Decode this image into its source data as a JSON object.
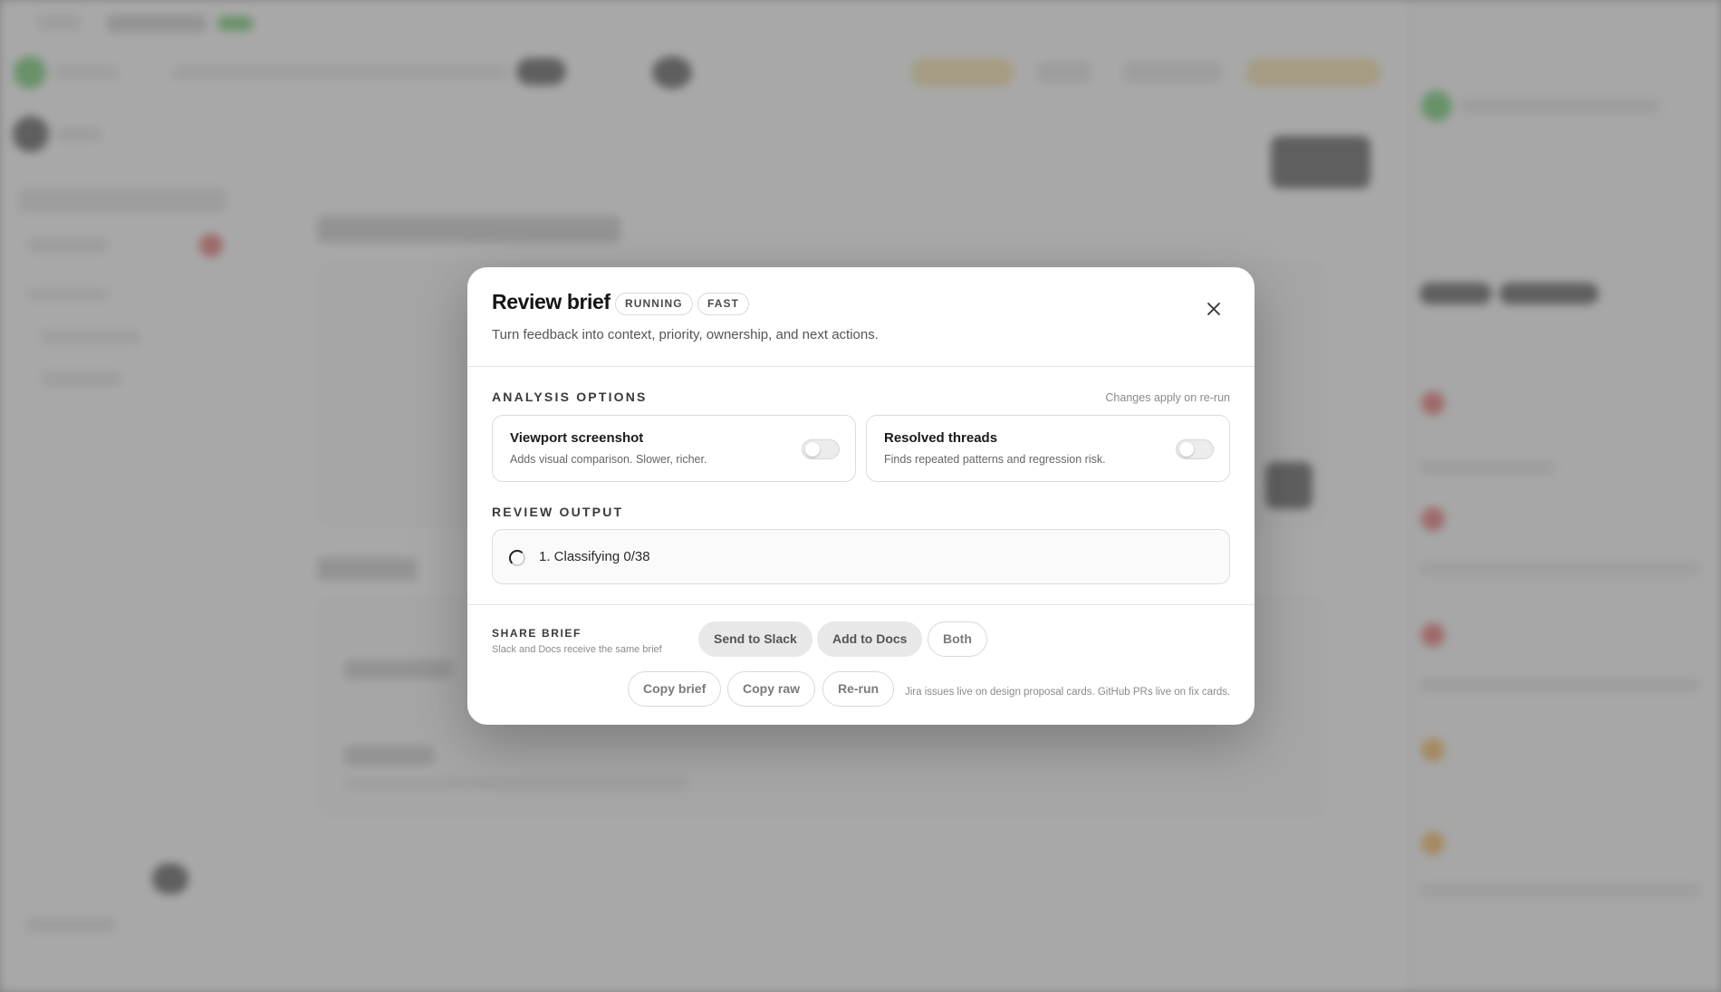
{
  "modal": {
    "title": "Review brief",
    "badges": [
      "RUNNING",
      "FAST"
    ],
    "subtitle": "Turn feedback into context, priority, ownership, and next actions.",
    "analysis": {
      "label": "ANALYSIS OPTIONS",
      "note": "Changes apply on re-run",
      "options": [
        {
          "title": "Viewport screenshot",
          "description": "Adds visual comparison. Slower, richer.",
          "enabled": false
        },
        {
          "title": "Resolved threads",
          "description": "Finds repeated patterns and regression risk.",
          "enabled": false
        }
      ]
    },
    "output": {
      "label": "REVIEW OUTPUT",
      "status": "1. Classifying 0/38"
    },
    "share": {
      "label": "SHARE BRIEF",
      "note": "Slack and Docs receive the same brief",
      "buttons": [
        "Send to Slack",
        "Add to Docs",
        "Both"
      ]
    },
    "actions": {
      "buttons": [
        "Copy brief",
        "Copy raw",
        "Re-run"
      ],
      "note": "Jira issues live on design proposal cards. GitHub PRs live on fix cards."
    }
  },
  "colors": {
    "overlay": "#8f8f8f",
    "modal_bg": "#ffffff",
    "accent_green": "#38b83a",
    "accent_red": "#e03b3b",
    "accent_orange": "#f0a020"
  }
}
